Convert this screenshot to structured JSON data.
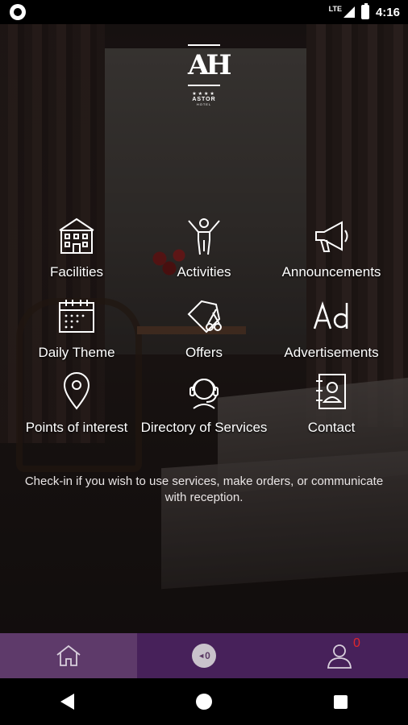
{
  "status_bar": {
    "network": "LTE",
    "time": "4:16"
  },
  "logo": {
    "mark": "AH",
    "stars": "★★★★",
    "name": "ASTOR",
    "sub": "HOTEL"
  },
  "menu": [
    {
      "label": "Facilities",
      "icon": "building-icon"
    },
    {
      "label": "Activities",
      "icon": "person-arms-up-icon"
    },
    {
      "label": "Announcements",
      "icon": "megaphone-icon"
    },
    {
      "label": "Daily Theme",
      "icon": "calendar-icon"
    },
    {
      "label": "Offers",
      "icon": "scissors-coupon-icon"
    },
    {
      "label": "Advertisements",
      "icon": "ad-icon"
    },
    {
      "label": "Points of interest",
      "icon": "map-pin-icon"
    },
    {
      "label": "Directory of Services",
      "icon": "headset-agent-icon"
    },
    {
      "label": "Contact",
      "icon": "contact-book-icon"
    }
  ],
  "checkin_message": "Check-in if you wish to use services, make orders, or communicate with reception.",
  "bottom_bar": {
    "cart_count": "0",
    "profile_badge": "0"
  },
  "colors": {
    "bottom_active": "#5e3a6a",
    "bottom_bg": "#47215a",
    "badge": "#e0262c"
  }
}
